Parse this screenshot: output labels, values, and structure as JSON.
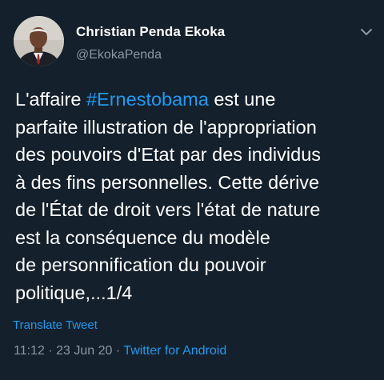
{
  "author": {
    "name": "Christian Penda Ekoka",
    "handle": "@EkokaPenda",
    "avatar_icon": "profile-photo"
  },
  "tweet": {
    "lines": [
      {
        "pre": "L'affaire ",
        "hashtag": "#Ernestobama",
        "post": " est une"
      },
      {
        "text": "parfaite illustration de l'appropriation"
      },
      {
        "text": "des pouvoirs d'Etat par des individus"
      },
      {
        "text": "à des fins personnelles. Cette dérive"
      },
      {
        "text": "de l'État de droit vers l'état de nature"
      },
      {
        "text": "est la conséquence du modèle"
      },
      {
        "text": "de personnification du pouvoir"
      },
      {
        "text": "politique,...1/4"
      }
    ],
    "translate_label": "Translate Tweet"
  },
  "meta": {
    "time": "11:12",
    "separator": " · ",
    "date": "23 Jun 20",
    "source": "Twitter for Android"
  },
  "colors": {
    "background": "#14202c",
    "link": "#1d9bf0",
    "secondary_text": "#8b98a5"
  },
  "icons": {
    "caret": "chevron-down-icon"
  }
}
